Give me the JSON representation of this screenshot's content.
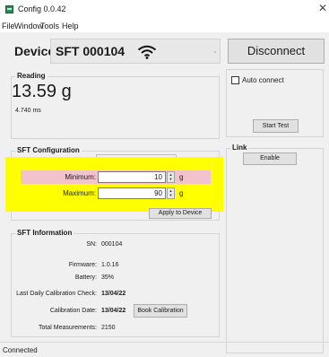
{
  "window": {
    "title": "Config 0.0.42",
    "close_glyph": "✕"
  },
  "menu": {
    "items": [
      "File",
      "Window",
      "Tools",
      "Help"
    ]
  },
  "devices": {
    "label": "Devices",
    "selected": "SFT 000104",
    "arrow": "⌄",
    "signal_icon": "wifi-icon"
  },
  "disconnect": {
    "label": "Disconnect"
  },
  "reading": {
    "title": "Reading",
    "value": "13.59 g",
    "time": "4.740 ms"
  },
  "auto": {
    "label": "Auto connect",
    "checked": false
  },
  "start_test": {
    "label": "Start Test"
  },
  "link": {
    "title": "Link",
    "enable_label": "Enable"
  },
  "config": {
    "title": "SFT Configuration",
    "minimum": {
      "label": "Minimum:",
      "value": "10",
      "unit": "g"
    },
    "maximum": {
      "label": "Maximum:",
      "value": "90",
      "unit": "g"
    },
    "apply_label": "Apply to Device"
  },
  "info": {
    "title": "SFT Information",
    "sn": {
      "label": "SN:",
      "value": "000104"
    },
    "firmware": {
      "label": "Firmware:",
      "value": "1.0.16"
    },
    "battery": {
      "label": "Battery:",
      "value": "35%"
    },
    "daily_check": {
      "label": "Last Daily Calibration Check:",
      "value": "13/04/22"
    },
    "calibration": {
      "label": "Calibration Date:",
      "value": "13/04/22"
    },
    "book_label": "Book Calibration",
    "measurements": {
      "label": "Total Measurements:",
      "value": "2150"
    }
  },
  "status": {
    "text": "Connected"
  },
  "colors": {
    "highlight": "#ffff00",
    "min_row": "#f2c3cc",
    "app_icon": "#2e8b57"
  }
}
